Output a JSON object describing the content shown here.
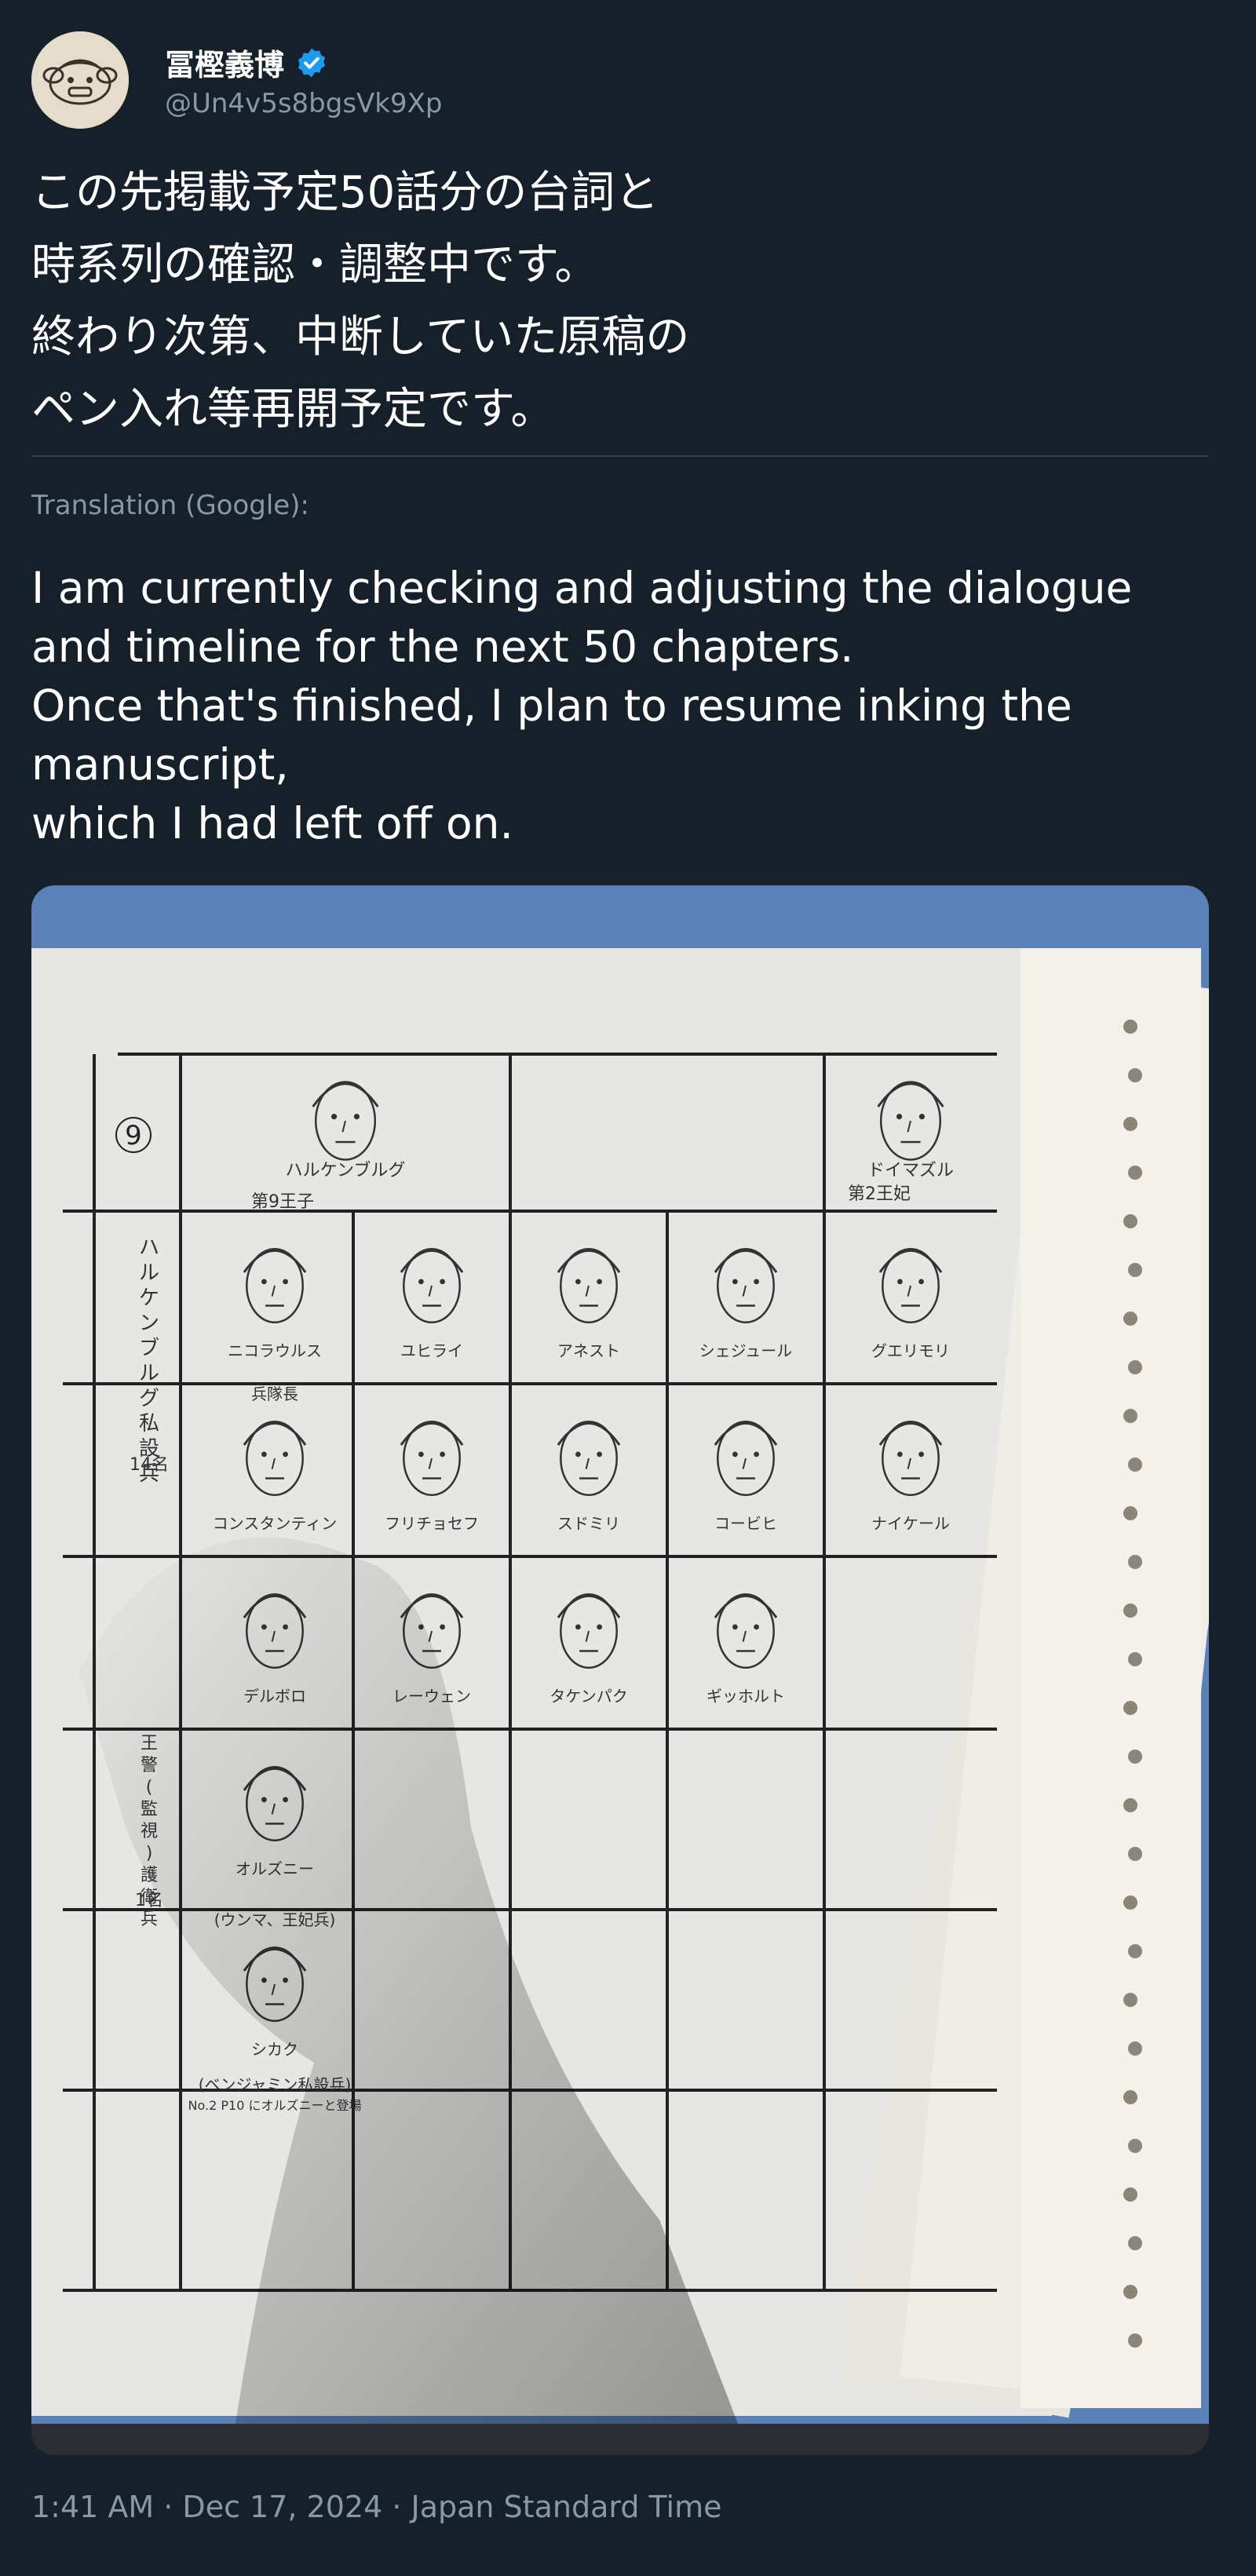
{
  "user": {
    "display_name": "冨樫義博",
    "handle": "@Un4v5s8bgsVk9Xp",
    "verified": true,
    "avatar_icon": "cartoon-face-avatar",
    "verified_color": "#1d9bf0"
  },
  "tweet": {
    "text_jp": "この先掲載予定50話分の台詞と\n時系列の確認・調整中です。\n終わり次第、中断していた原稿の\nペン入れ等再開予定です。",
    "translation_label": "Translation (Google):",
    "text_en": "I am currently checking and adjusting the dialogue\nand timeline for the next 50 chapters.\nOnce that's finished, I plan to resume inking the\nmanuscript,\nwhich I had left off on.",
    "timestamp": "1:41 AM · Dec 17, 2024 · Japan Standard Time"
  },
  "photo": {
    "page_number": "9",
    "top_row": [
      "ハルケンブルグ",
      "",
      "ドイマズル"
    ],
    "top_row_sub": [
      "第9王子",
      "",
      "第2王妃"
    ],
    "side_labels": [
      "ハルケンブルグ私設兵",
      "14名",
      "王警(監視)護衛兵",
      "1名"
    ],
    "grid_names": [
      [
        "ニコラウルス",
        "ユヒライ",
        "アネスト",
        "シェジュール",
        "グエリモリ"
      ],
      [
        "コンスタンティン",
        "フリチョセフ",
        "スドミリ",
        "コービヒ",
        "ナイケール"
      ],
      [
        "デルボロ",
        "レーウェン",
        "タケンパク",
        "ギッホルト",
        ""
      ],
      [
        "オルズニー",
        "",
        "",
        "",
        ""
      ],
      [
        "シカク",
        "",
        "",
        "",
        ""
      ]
    ],
    "notes": [
      "兵隊長",
      "(ウンマ、王妃兵)",
      "(ベンジャミン私設兵)",
      "No.2 P10 にオルズニーと登場"
    ]
  }
}
